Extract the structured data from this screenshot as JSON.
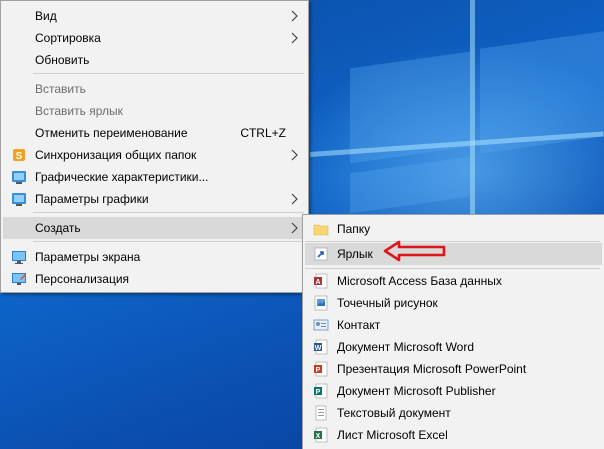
{
  "context_menu": {
    "items": [
      {
        "label": "Вид"
      },
      {
        "label": "Сортировка"
      },
      {
        "label": "Обновить"
      },
      {
        "label": "Вставить"
      },
      {
        "label": "Вставить ярлык"
      },
      {
        "label": "Отменить переименование",
        "shortcut": "CTRL+Z"
      },
      {
        "label": "Синхронизация общих папок"
      },
      {
        "label": "Графические характеристики..."
      },
      {
        "label": "Параметры графики"
      },
      {
        "label": "Создать"
      },
      {
        "label": "Параметры экрана"
      },
      {
        "label": "Персонализация"
      }
    ]
  },
  "submenu": {
    "items": [
      {
        "label": "Папку"
      },
      {
        "label": "Ярлык"
      },
      {
        "label": "Microsoft Access База данных"
      },
      {
        "label": "Точечный рисунок"
      },
      {
        "label": "Контакт"
      },
      {
        "label": "Документ Microsoft Word"
      },
      {
        "label": "Презентация Microsoft PowerPoint"
      },
      {
        "label": "Документ Microsoft Publisher"
      },
      {
        "label": "Текстовый документ"
      },
      {
        "label": "Лист Microsoft Excel"
      }
    ]
  },
  "icons": {
    "sync": "sync-icon",
    "graphics": "intel-graphics-icon",
    "display": "display-settings-icon",
    "personalize": "personalization-icon",
    "folder": "folder-icon",
    "shortcut": "shortcut-icon",
    "access": "access-icon",
    "bitmap": "bitmap-icon",
    "contact": "contact-icon",
    "word": "word-icon",
    "powerpoint": "powerpoint-icon",
    "publisher": "publisher-icon",
    "text": "text-document-icon",
    "excel": "excel-icon"
  },
  "colors": {
    "desktop": "#0e64c7",
    "menu_bg": "#f2f2f2",
    "highlight": "#d9d9d9",
    "pointer_arrow": "#e0141b"
  }
}
